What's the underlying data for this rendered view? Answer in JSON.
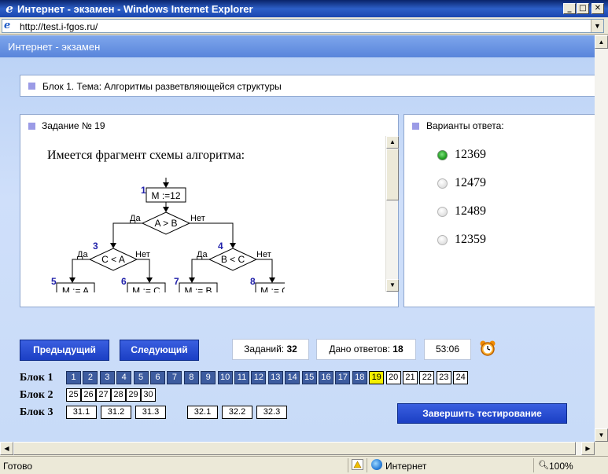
{
  "window": {
    "title": "Интернет - экзамен - Windows Internet Explorer",
    "min": "_",
    "max": "□",
    "close": "✕"
  },
  "address": {
    "url": "http://test.i-fgos.ru/"
  },
  "page": {
    "header": "Интернет - экзамен",
    "block_title": "Блок 1. Тема: Алгоритмы разветвляющейся структуры",
    "task_label": "Задание № 19",
    "task_heading": "Имеется фрагмент схемы алгоритма:",
    "answers_label": "Варианты ответа:",
    "answers": [
      {
        "text": "12369",
        "selected": true
      },
      {
        "text": "12479",
        "selected": false
      },
      {
        "text": "12489",
        "selected": false
      },
      {
        "text": "12359",
        "selected": false
      }
    ]
  },
  "flowchart": {
    "nodes": {
      "n1": {
        "num": "1",
        "text": "M :=12"
      },
      "n2": {
        "text": "A > B",
        "yes": "Да",
        "no": "Нет"
      },
      "n3": {
        "num": "3",
        "text": "C < A",
        "yes": "Да",
        "no": "Нет"
      },
      "n4": {
        "num": "4",
        "text": "B < C",
        "yes": "Да",
        "no": "Нет"
      },
      "n5": {
        "num": "5",
        "text": "M := A"
      },
      "n6": {
        "num": "6",
        "text": "M := C"
      },
      "n7": {
        "num": "7",
        "text": "M := B"
      },
      "n8": {
        "num": "8",
        "text": "M := C"
      }
    }
  },
  "nav": {
    "prev": "Предыдущий",
    "next": "Следующий",
    "tasks_label": "Заданий:",
    "tasks_value": "32",
    "answered_label": "Дано ответов:",
    "answered_value": "18",
    "timer": "53:06",
    "finish": "Завершить тестирование"
  },
  "blocks": [
    {
      "label": "Блок 1",
      "items": [
        "1",
        "2",
        "3",
        "4",
        "5",
        "6",
        "7",
        "8",
        "9",
        "10",
        "11",
        "12",
        "13",
        "14",
        "15",
        "16",
        "17",
        "18",
        "19",
        "20",
        "21",
        "22",
        "23",
        "24"
      ],
      "answered_count": 18,
      "current": "19"
    },
    {
      "label": "Блок 2",
      "items": [
        "25",
        "26",
        "27",
        "28",
        "29",
        "30"
      ]
    },
    {
      "label": "Блок 3",
      "items": [
        "31.1",
        "31.2",
        "31.3",
        "32.1",
        "32.2",
        "32.3"
      ]
    }
  ],
  "status": {
    "text": "Готово",
    "zone": "Интернет",
    "zoom": "100%"
  },
  "colors": {
    "answered": "#3d5c9f",
    "current": "#f5f000",
    "button": "#1b3fc4",
    "header": "#5985db"
  }
}
